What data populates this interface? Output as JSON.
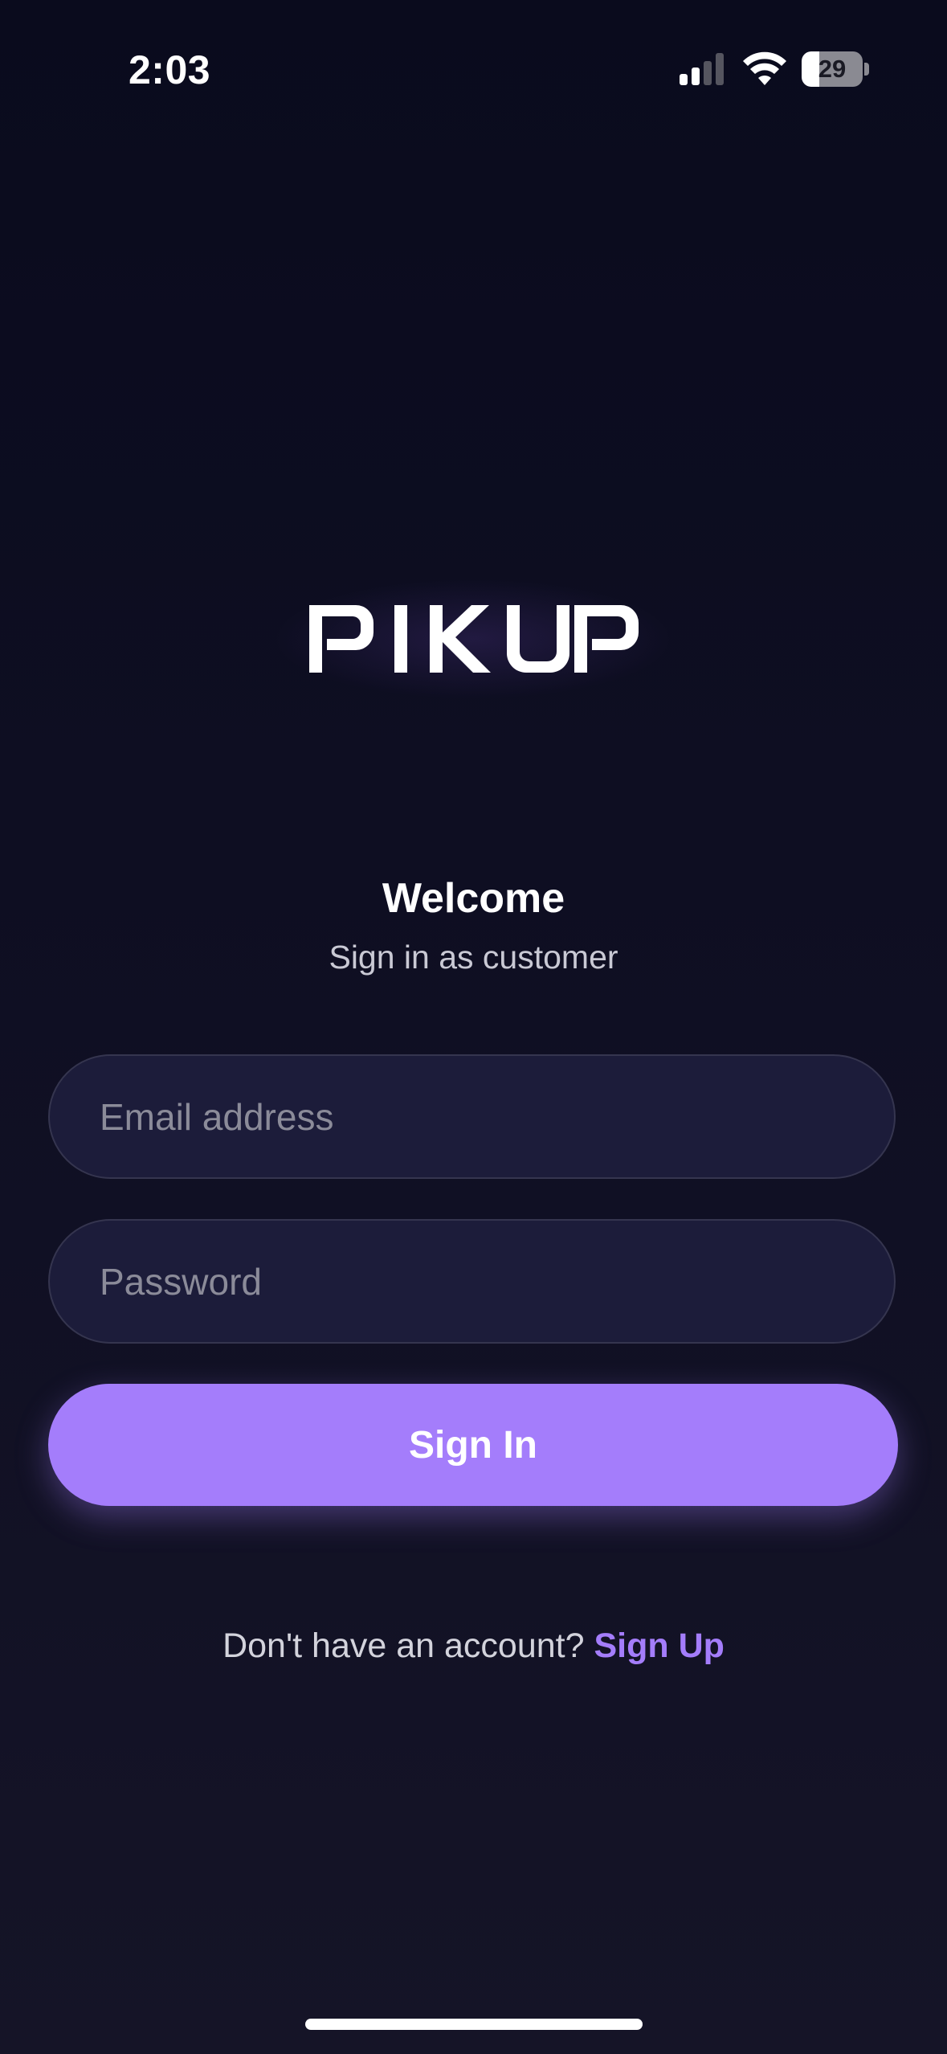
{
  "status_bar": {
    "time": "2:03",
    "battery_level": "29",
    "battery_fraction": 0.29,
    "signal_bars_active": 2,
    "signal_bars_total": 4,
    "icons": [
      "signal-icon",
      "wifi-icon",
      "battery-icon"
    ]
  },
  "brand": {
    "logo_text": "PIKUP"
  },
  "header": {
    "title": "Welcome",
    "subtitle": "Sign in as customer"
  },
  "form": {
    "email": {
      "placeholder": "Email address",
      "value": ""
    },
    "password": {
      "placeholder": "Password",
      "value": ""
    },
    "submit_label": "Sign In"
  },
  "footer": {
    "prompt": "Don't have an account?",
    "link_label": "Sign Up"
  },
  "colors": {
    "accent": "#a47dfb",
    "background": "#0e0e22",
    "field_background": "#1c1c3a"
  }
}
